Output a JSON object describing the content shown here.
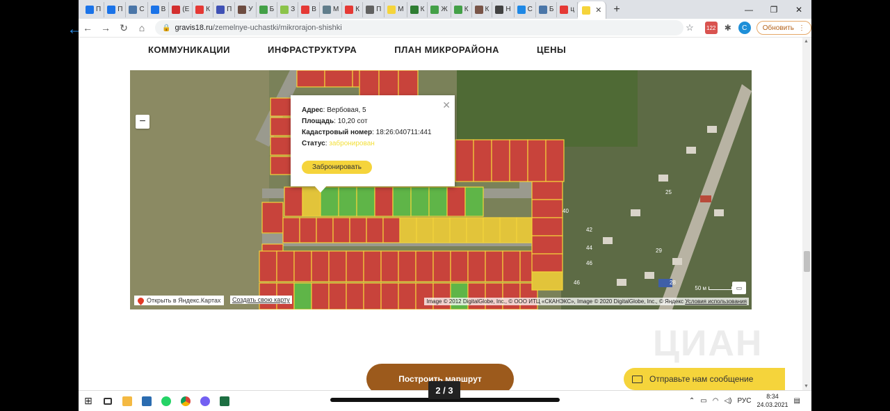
{
  "browser": {
    "tabs": [
      {
        "icon": "mail-icon",
        "label": "П",
        "color": "#1a73e8"
      },
      {
        "icon": "mail-icon",
        "label": "П",
        "color": "#1a73e8"
      },
      {
        "icon": "vk-icon",
        "label": "С",
        "color": "#4a76a8"
      },
      {
        "icon": "mail-icon",
        "label": "В",
        "color": "#1a73e8"
      },
      {
        "icon": "news-icon",
        "label": "(Е",
        "color": "#d32f2f"
      },
      {
        "icon": "map-pin-icon",
        "label": "К",
        "color": "#e53935"
      },
      {
        "icon": "grid-icon",
        "label": "П",
        "color": "#3f51b5"
      },
      {
        "icon": "globe-icon",
        "label": "У",
        "color": "#6d4c41"
      },
      {
        "icon": "dots-icon",
        "label": "Б",
        "color": "#43a047"
      },
      {
        "icon": "chart-icon",
        "label": "З",
        "color": "#8bc34a"
      },
      {
        "icon": "map-pin-icon",
        "label": "В",
        "color": "#e53935"
      },
      {
        "icon": "cloud-icon",
        "label": "М",
        "color": "#607d8b"
      },
      {
        "icon": "yandex-icon",
        "label": "К",
        "color": "#e53935"
      },
      {
        "icon": "doc-icon",
        "label": "П",
        "color": "#616161"
      },
      {
        "icon": "yellow-tab-icon",
        "label": "М",
        "color": "#f5d43b"
      },
      {
        "icon": "bookmark-icon",
        "label": "К",
        "color": "#2e7d32"
      },
      {
        "icon": "dots-icon",
        "label": "Ж",
        "color": "#43a047"
      },
      {
        "icon": "dots-icon",
        "label": "К",
        "color": "#43a047"
      },
      {
        "icon": "layers-icon",
        "label": "К",
        "color": "#795548"
      },
      {
        "icon": "tools-icon",
        "label": "Н",
        "color": "#424242"
      },
      {
        "icon": "drop-icon",
        "label": "С",
        "color": "#1e88e5"
      },
      {
        "icon": "vk-icon",
        "label": "Б",
        "color": "#4a76a8"
      },
      {
        "icon": "yandex-icon",
        "label": "ц",
        "color": "#e53935"
      }
    ],
    "active_tab_icon_color": "#f5d43b",
    "url_host": "gravis18.ru",
    "url_path": "/zemelnye-uchastki/mikrorajon-shishki",
    "ext_badge": "122",
    "avatar_letter": "C",
    "update_label": "Обновить"
  },
  "site_nav": [
    "КОММУНИКАЦИИ",
    "ИНФРАСТРУКТУРА",
    "ПЛАН МИКРОРАЙОНА",
    "ЦЕНЫ"
  ],
  "balloon": {
    "address_label": "Адрес",
    "address_value": ": Вербовая, 5",
    "area_label": "Площадь",
    "area_value": ": 10,20 сот",
    "cadastral_label": "Кадастровый номер",
    "cadastral_value": ": 18:26:040711:441",
    "status_label": "Статус",
    "status_value": "забронирован",
    "reserve_button": "Забронировать"
  },
  "map": {
    "open_yandex": "Открыть в Яндекс.Картах",
    "create_map": "Создать свою карту",
    "copyright": "Image © 2012 DigitalGlobe, Inc., © ООО ИТЦ «СКАНЭКС», Image © 2020 DigitalGlobe, Inc., © Яндекс",
    "terms": "Условия использования",
    "scale": "50 м",
    "house_numbers": [
      "40",
      "42",
      "44",
      "46",
      "46",
      "29",
      "28",
      "25"
    ],
    "colors": {
      "sold": "#c8433b",
      "free": "#5fb548",
      "reserved": "#e2c43a"
    }
  },
  "route_button": "Построить маршрут",
  "chat_button": "Отправьте нам сообщение",
  "watermark": "ЦИАН",
  "pager": "2 / 3",
  "taskbar": {
    "lang": "РУС",
    "time": "8:34",
    "date": "24.03.2021"
  }
}
